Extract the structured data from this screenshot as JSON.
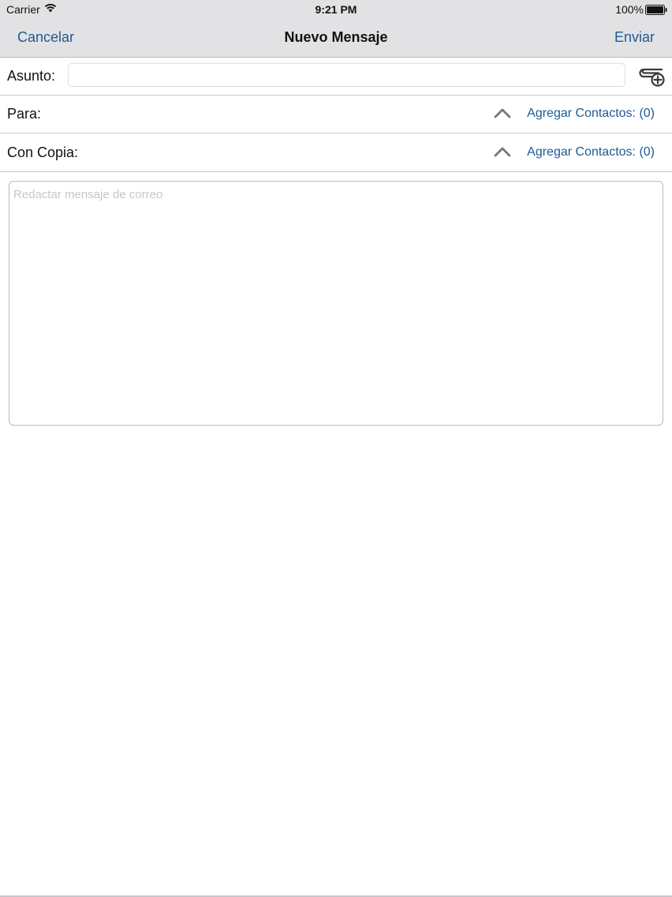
{
  "status_bar": {
    "carrier": "Carrier",
    "time": "9:21 PM",
    "battery": "100%"
  },
  "nav": {
    "cancel_label": "Cancelar",
    "title": "Nuevo Mensaje",
    "send_label": "Enviar"
  },
  "form": {
    "subject_label": "Asunto:",
    "subject_value": "",
    "to_label": "Para:",
    "to_add_label": "Agregar Contactos: (0)",
    "cc_label": "Con Copia:",
    "cc_add_label": "Agregar Contactos: (0)",
    "message_placeholder": "Redactar mensaje de correo"
  },
  "icons": {
    "wifi": "wifi-icon",
    "battery": "battery-icon",
    "attach": "attachment-add-icon",
    "chevron": "chevron-up-icon"
  },
  "colors": {
    "accent": "#1d5b94",
    "nav_background": "#e2e2e4"
  }
}
